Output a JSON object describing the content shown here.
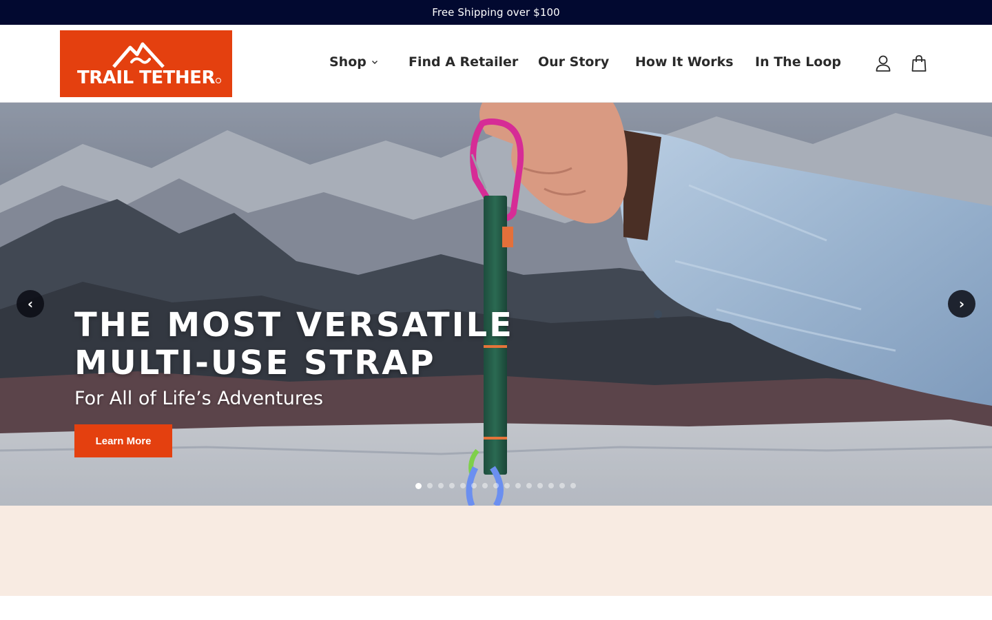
{
  "announcement": {
    "text": "Free Shipping over $100"
  },
  "header": {
    "logo_text": "TRAIL TETHER",
    "nav": {
      "shop": "Shop",
      "retailer": "Find A Retailer",
      "story": "Our Story",
      "how": "How It Works",
      "loop": "In The Loop"
    },
    "icons": {
      "account": "account-icon",
      "bag": "shopping-bag-icon",
      "shop_dropdown": "chevron-down-icon"
    }
  },
  "hero": {
    "heading_line1": "THE MOST VERSATILE",
    "heading_line2": "MULTI-USE STRAP",
    "subheading": "For All of Life’s Adventures",
    "cta_label": "Learn More",
    "prev_arrow": "‹",
    "next_arrow": "›",
    "slide_count": 15,
    "active_slide": 1
  },
  "colors": {
    "brand_orange": "#e4400f",
    "announcement_bg": "#020930",
    "peach_bg": "#f8ebe2"
  }
}
